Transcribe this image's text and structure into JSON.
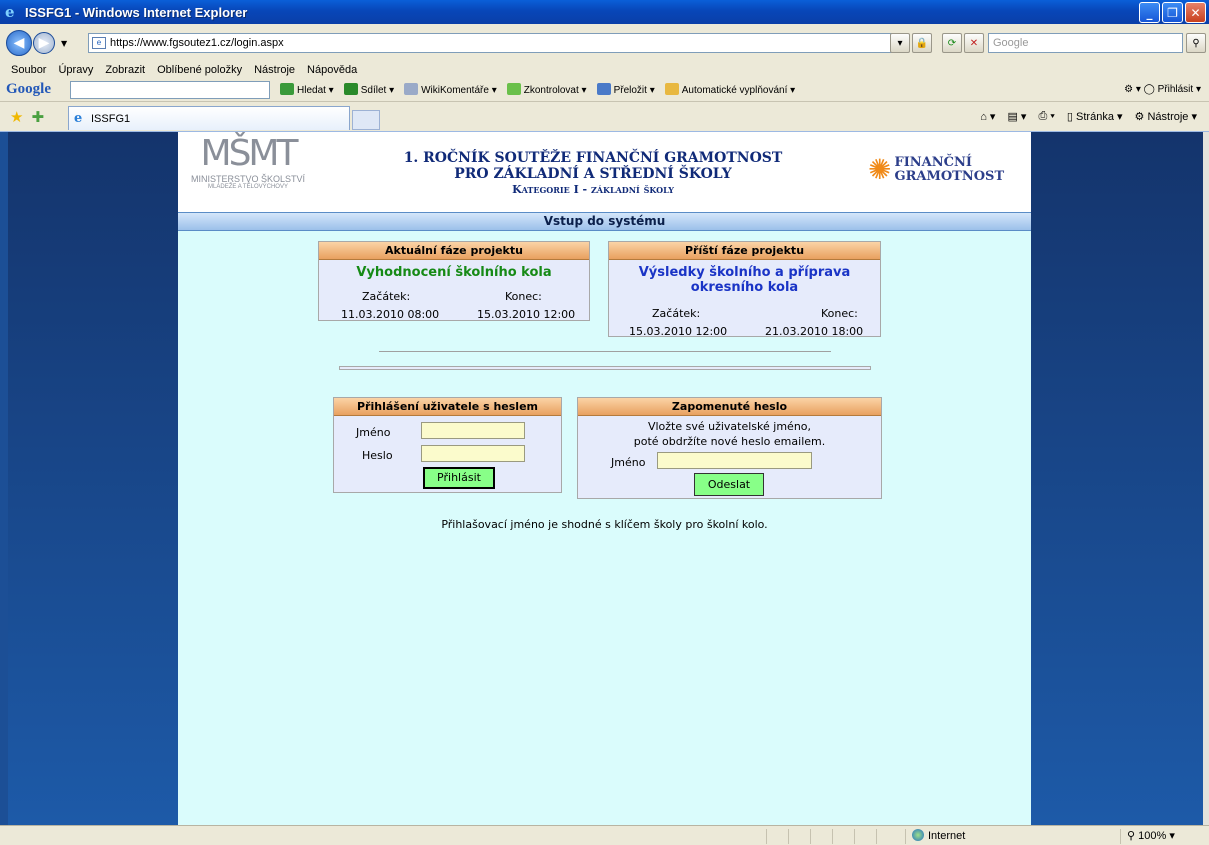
{
  "window": {
    "title": "ISSFG1 - Windows Internet Explorer"
  },
  "address": {
    "url": "https://www.fgsoutez1.cz/login.aspx",
    "search_placeholder": "Google"
  },
  "menu": [
    "Soubor",
    "Úpravy",
    "Zobrazit",
    "Oblíbené položky",
    "Nástroje",
    "Nápověda"
  ],
  "google_toolbar": {
    "logo": "Google",
    "items": [
      "Hledat",
      "Sdílet",
      "WikiKomentáře",
      "Zkontrolovat",
      "Přeložit",
      "Automatické vyplňování"
    ],
    "signin": "Přihlásit"
  },
  "tabs": {
    "active": "ISSFG1"
  },
  "commandbar": {
    "page": "Stránka",
    "tools": "Nástroje"
  },
  "header": {
    "ministry_logo": "MŠMT",
    "ministry_name": "MINISTERSTVO ŠKOLSTVÍ",
    "ministry_sub": "MLÁDEŽE A TĚLOVÝCHOVY",
    "title_line1": "1. ROČNÍK SOUTĚŽE FINANČNÍ GRAMOTNOST",
    "title_line2": "PRO ZÁKLADNÍ A STŘEDNÍ ŠKOLY",
    "title_line3": "Kategorie I - základní školy",
    "brand_line1": "FINANČNÍ",
    "brand_line2": "GRAMOTNOST"
  },
  "section_title": "Vstup do systému",
  "current_phase": {
    "heading": "Aktuální fáze projektu",
    "name": "Vyhodnocení školního kola",
    "start_label": "Začátek:",
    "end_label": "Konec:",
    "start": "11.03.2010 08:00",
    "end": "15.03.2010 12:00"
  },
  "next_phase": {
    "heading": "Příští fáze projektu",
    "name_line1": "Výsledky školního a příprava",
    "name_line2": "okresního kola",
    "start_label": "Začátek:",
    "end_label": "Konec:",
    "start": "15.03.2010 12:00",
    "end": "21.03.2010 18:00"
  },
  "login": {
    "heading": "Přihlášení uživatele s heslem",
    "name_label": "Jméno",
    "password_label": "Heslo",
    "name_value": "",
    "password_value": "",
    "button": "Přihlásit"
  },
  "forgot": {
    "heading": "Zapomenuté heslo",
    "text_line1": "Vložte své uživatelské jméno,",
    "text_line2": "poté obdržíte nové heslo emailem.",
    "name_label": "Jméno",
    "name_value": "",
    "button": "Odeslat"
  },
  "note": "Přihlašovací jméno je shodné s klíčem školy pro školní kolo.",
  "status": {
    "zone": "Internet",
    "zoom": "100%"
  }
}
